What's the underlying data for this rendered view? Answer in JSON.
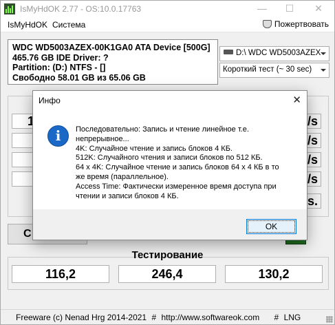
{
  "window": {
    "title": "IsMyHdOK 2.77 - OS:10.0.17763",
    "min_glyph": "—",
    "max_glyph": "☐",
    "close_glyph": "✕"
  },
  "menu": {
    "items": [
      "IsMyHdOK",
      "Система"
    ],
    "donate_label": "Пожертвовать"
  },
  "drive_info": {
    "line1": "WDC WD5003AZEX-00K1GA0 ATA Device [500G]",
    "line2": "465.76 GB  IDE Driver: ?",
    "line3": "Partition: (D:) NTFS - []",
    "line4": "Свободно 58.01 GB из 65.06 GB"
  },
  "controls": {
    "drive_select": "D:\\ WDC WD5003AZEX",
    "test_select": "Короткий тест (~ 30 sec)"
  },
  "metrics": {
    "left_values": [
      "1",
      "",
      "",
      ""
    ],
    "right_values": [
      "/s",
      "/s",
      "/s",
      "/s",
      "s."
    ]
  },
  "start_button_label": "С",
  "testing": {
    "title": "Тестирование",
    "results": [
      "116,2",
      "246,4",
      "130,2"
    ]
  },
  "status": {
    "freeware": "Freeware (c) Nenad Hrg 2014-2021",
    "hash1": "#",
    "url": "http://www.softwareok.com",
    "hash2": "#",
    "lng": "LNG"
  },
  "dialog": {
    "title": "Инфо",
    "close_glyph": "✕",
    "icon_glyph": "i",
    "lines": [
      "Последовательно: Запись и чтение линейное т.е.",
      "непрерывное...",
      "4K: Случайное чтение и запись блоков 4 КБ.",
      "512K: Случайного чтения и записи блоков по 512 КБ.",
      "64 x 4K: Случайное чтение и запись блоков 64 x 4 КБ в то",
      "же время (параллельное).",
      "Access Time: Фактически измеренное время доступа при",
      "чтении и записи блоков 4 КБ."
    ],
    "ok_label": "OK"
  },
  "colors": {
    "accent": "#0078d7",
    "info_icon": "#1a69c7"
  }
}
